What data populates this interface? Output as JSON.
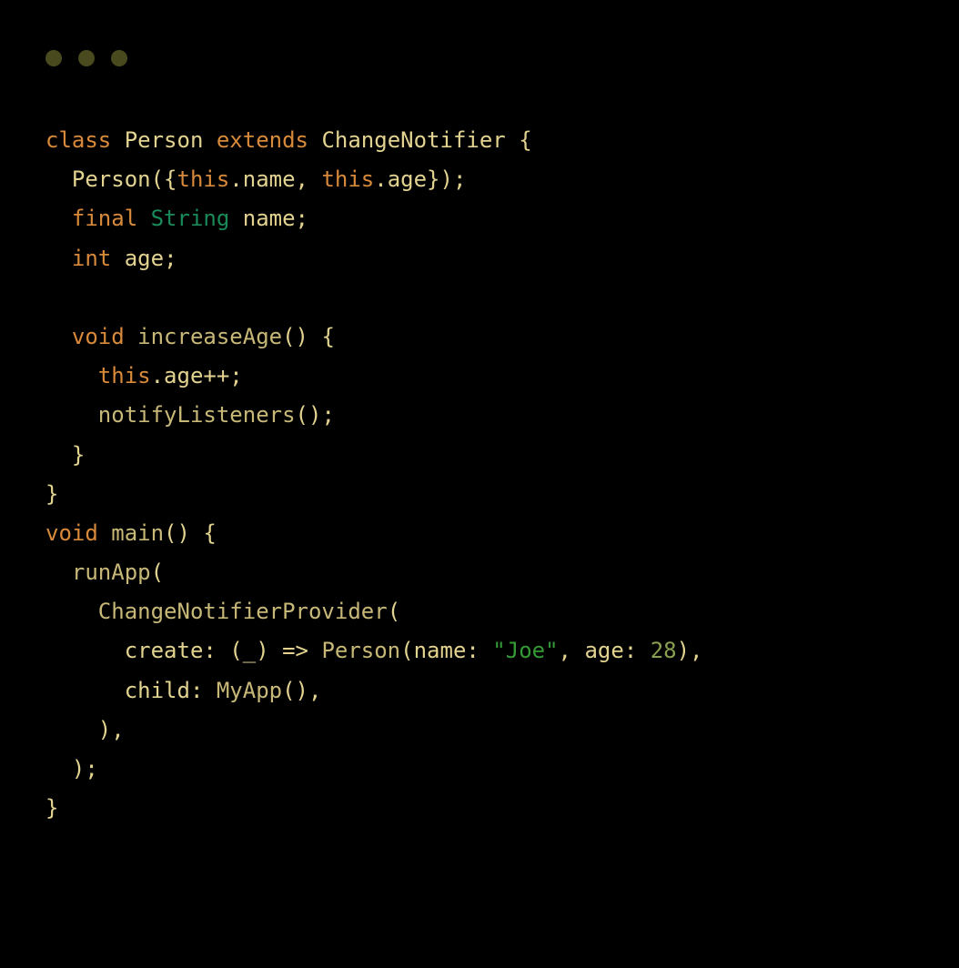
{
  "code": {
    "tokens": [
      {
        "cls": "kw",
        "text": "class"
      },
      {
        "cls": "",
        "text": " Person "
      },
      {
        "cls": "kw",
        "text": "extends"
      },
      {
        "cls": "",
        "text": " ChangeNotifier {\n  Person({"
      },
      {
        "cls": "kw",
        "text": "this"
      },
      {
        "cls": "",
        "text": ".name, "
      },
      {
        "cls": "kw",
        "text": "this"
      },
      {
        "cls": "",
        "text": ".age});\n  "
      },
      {
        "cls": "kw",
        "text": "final"
      },
      {
        "cls": "",
        "text": " "
      },
      {
        "cls": "type",
        "text": "String"
      },
      {
        "cls": "",
        "text": " name;\n  "
      },
      {
        "cls": "kw",
        "text": "int"
      },
      {
        "cls": "",
        "text": " age;\n\n  "
      },
      {
        "cls": "kw",
        "text": "void"
      },
      {
        "cls": "",
        "text": " "
      },
      {
        "cls": "fn",
        "text": "increaseAge"
      },
      {
        "cls": "",
        "text": "() {\n    "
      },
      {
        "cls": "kw",
        "text": "this"
      },
      {
        "cls": "",
        "text": ".age++;\n    "
      },
      {
        "cls": "fn",
        "text": "notifyListeners"
      },
      {
        "cls": "",
        "text": "();\n  }\n}\n"
      },
      {
        "cls": "kw",
        "text": "void"
      },
      {
        "cls": "",
        "text": " "
      },
      {
        "cls": "fn",
        "text": "main"
      },
      {
        "cls": "",
        "text": "() {\n  "
      },
      {
        "cls": "fn",
        "text": "runApp"
      },
      {
        "cls": "",
        "text": "(\n    "
      },
      {
        "cls": "fn",
        "text": "ChangeNotifierProvider"
      },
      {
        "cls": "",
        "text": "(\n      create: (_) => "
      },
      {
        "cls": "fn",
        "text": "Person"
      },
      {
        "cls": "",
        "text": "(name: "
      },
      {
        "cls": "str",
        "text": "\"Joe\""
      },
      {
        "cls": "",
        "text": ", age: "
      },
      {
        "cls": "num",
        "text": "28"
      },
      {
        "cls": "",
        "text": "),\n      child: "
      },
      {
        "cls": "fn",
        "text": "MyApp"
      },
      {
        "cls": "",
        "text": "(),\n    ),\n  );\n}"
      }
    ]
  }
}
